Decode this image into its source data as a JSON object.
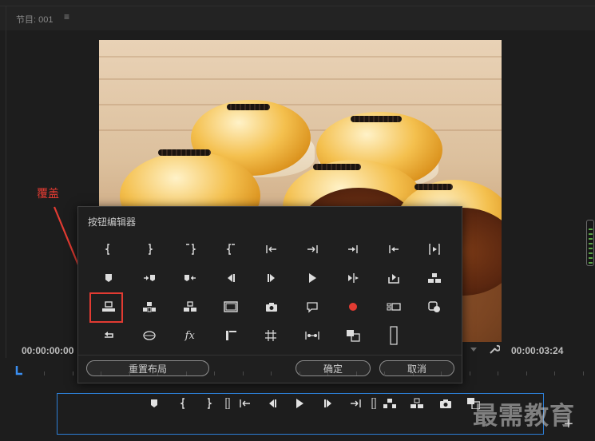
{
  "panel": {
    "title": "节目: 001",
    "menu_glyph": "≡"
  },
  "annotation": {
    "label": "覆盖",
    "color": "#e23b32"
  },
  "button_editor": {
    "title": "按钮编辑器",
    "reset_label": "重置布局",
    "ok_label": "确定",
    "cancel_label": "取消",
    "icons": [
      "mark-in-icon",
      "mark-out-icon",
      "mark-clip-in-icon",
      "mark-clip-out-icon",
      "go-to-in-icon",
      "go-to-out-icon",
      "go-to-next-edit-icon",
      "go-to-previous-edit-icon",
      "play-in-to-out-icon",
      "add-marker-icon",
      "go-to-next-marker-icon",
      "go-to-previous-marker-icon",
      "step-back-icon",
      "step-forward-icon",
      "play-icon",
      "trim-icon",
      "export-frame-icon",
      "insert-icon",
      "overwrite-icon",
      "lift-icon",
      "extract-icon",
      "safe-margins-icon",
      "camera-icon",
      "comment-icon",
      "record-icon",
      "multicam-icon",
      "global-fx-mute-icon",
      "loop-icon",
      "vr-video-icon",
      "fx-icon",
      "proxy-icon",
      "transmit-icon",
      "compare-view-icon",
      "overlay-frame-icon",
      "spacer-icon"
    ],
    "selected_icon": "overwrite-icon",
    "fx_text": "fx"
  },
  "timecode": {
    "current": "00:00:00:00",
    "duration": "00:00:03:24"
  },
  "transport_icons": [
    "add-marker-icon",
    "mark-in-icon",
    "mark-out-icon",
    "spacer-icon",
    "go-to-in-icon",
    "step-back-icon",
    "play-icon",
    "step-forward-icon",
    "go-to-out-icon",
    "spacer-icon",
    "lift-icon",
    "extract-icon",
    "camera-icon",
    "compare-view-icon"
  ],
  "watermark": "最需教育",
  "add_glyph": "+"
}
